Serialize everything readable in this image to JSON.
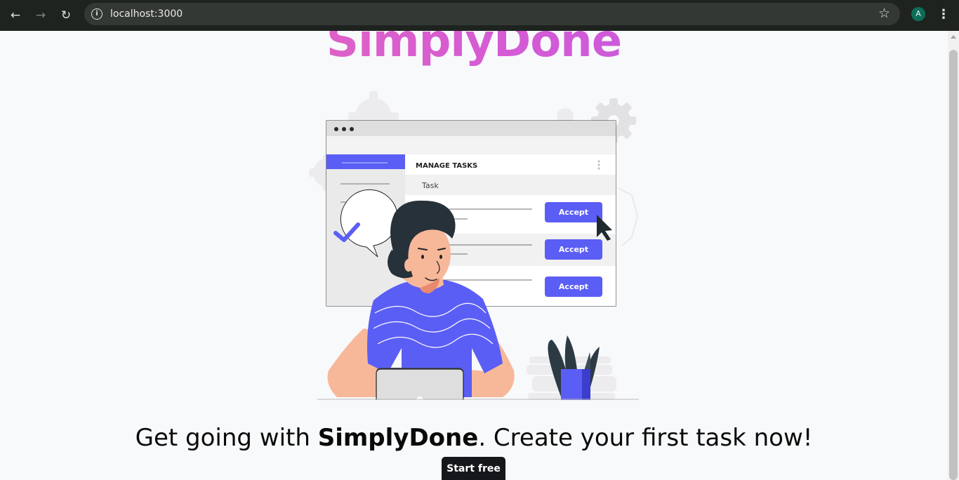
{
  "browser": {
    "url": "localhost:3000",
    "back_icon": "←",
    "forward_icon": "→",
    "reload_icon": "↻",
    "info_icon": "i",
    "star_icon": "☆",
    "avatar_letter": "A",
    "menu_icon": "⋮"
  },
  "hero": {
    "brand": "SimplyDone",
    "headline_prefix": "Get going with ",
    "headline_brand": "SimplyDone",
    "headline_suffix": ". Create your first task now!",
    "cta_label": "Start free"
  },
  "illustration": {
    "panel_title": "MANAGE TASKS",
    "column_label": "Task",
    "accept_labels": [
      "Accept",
      "Accept",
      "Accept"
    ]
  },
  "colors": {
    "accent": "#5b5ef5",
    "brand_gradient_start": "#ee6bb0",
    "brand_gradient_end": "#b759e6",
    "cta_bg": "#16171a"
  }
}
